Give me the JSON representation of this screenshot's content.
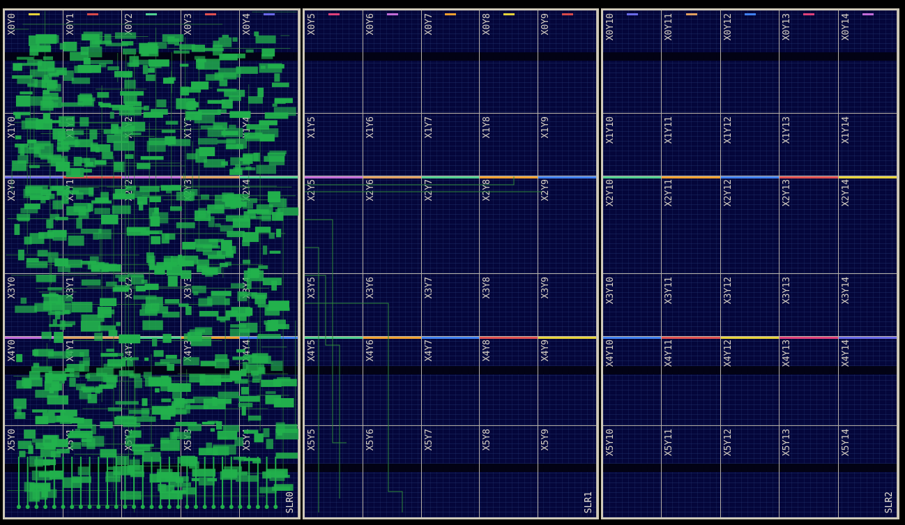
{
  "slrs": [
    {
      "label": "SLR0",
      "columns": 5,
      "rows": [
        [
          "X0Y0",
          "X0Y1",
          "X0Y2",
          "X0Y3",
          "X0Y4"
        ],
        [
          "X1Y0",
          "X1Y1",
          "X1Y2",
          "X1Y3",
          "X1Y4"
        ],
        [
          "X2Y0",
          "X2Y1",
          "X2Y2",
          "X2Y3",
          "X2Y4"
        ],
        [
          "X3Y0",
          "X3Y1",
          "X3Y2",
          "X3Y3",
          "X3Y4"
        ],
        [
          "X4Y0",
          "X4Y1",
          "X4Y2",
          "X4Y3",
          "X4Y4"
        ],
        [
          "X5Y0",
          "X5Y1",
          "X5Y2",
          "X5Y3",
          "X5Y4"
        ]
      ],
      "placed_logic": true
    },
    {
      "label": "SLR1",
      "columns": 5,
      "rows": [
        [
          "X0Y5",
          "X0Y6",
          "X0Y7",
          "X0Y8",
          "X0Y9"
        ],
        [
          "X1Y5",
          "X1Y6",
          "X1Y7",
          "X1Y8",
          "X1Y9"
        ],
        [
          "X2Y5",
          "X2Y6",
          "X2Y7",
          "X2Y8",
          "X2Y9"
        ],
        [
          "X3Y5",
          "X3Y6",
          "X3Y7",
          "X3Y8",
          "X3Y9"
        ],
        [
          "X4Y5",
          "X4Y6",
          "X4Y7",
          "X4Y8",
          "X4Y9"
        ],
        [
          "X5Y5",
          "X5Y6",
          "X5Y7",
          "X5Y8",
          "X5Y9"
        ]
      ],
      "placed_logic": false
    },
    {
      "label": "SLR2",
      "columns": 5,
      "rows": [
        [
          "X0Y10",
          "X0Y11",
          "X0Y12",
          "X0Y13",
          "X0Y14"
        ],
        [
          "X1Y10",
          "X1Y11",
          "X1Y12",
          "X1Y13",
          "X1Y14"
        ],
        [
          "X2Y10",
          "X2Y11",
          "X2Y12",
          "X2Y13",
          "X2Y14"
        ],
        [
          "X3Y10",
          "X3Y11",
          "X3Y12",
          "X3Y13",
          "X3Y14"
        ],
        [
          "X4Y10",
          "X4Y11",
          "X4Y12",
          "X4Y13",
          "X4Y14"
        ],
        [
          "X5Y10",
          "X5Y11",
          "X5Y12",
          "X5Y13",
          "X5Y14"
        ]
      ],
      "placed_logic": false
    }
  ],
  "colors": {
    "background": "#000000",
    "fabric": "#04063a",
    "region_border": "#b9b3a8",
    "slr_border": "#cfc9b8",
    "placed_cells": "#22b14c",
    "route": "#2e8b3a",
    "label_text": "#d9d2c5",
    "clock_markers": [
      "#e6d23a",
      "#e0407a",
      "#6a6ae8",
      "#d84a4a",
      "#c36bd8",
      "#e0a060",
      "#50d090",
      "#f0a030",
      "#4080f0",
      "#e05050"
    ]
  }
}
